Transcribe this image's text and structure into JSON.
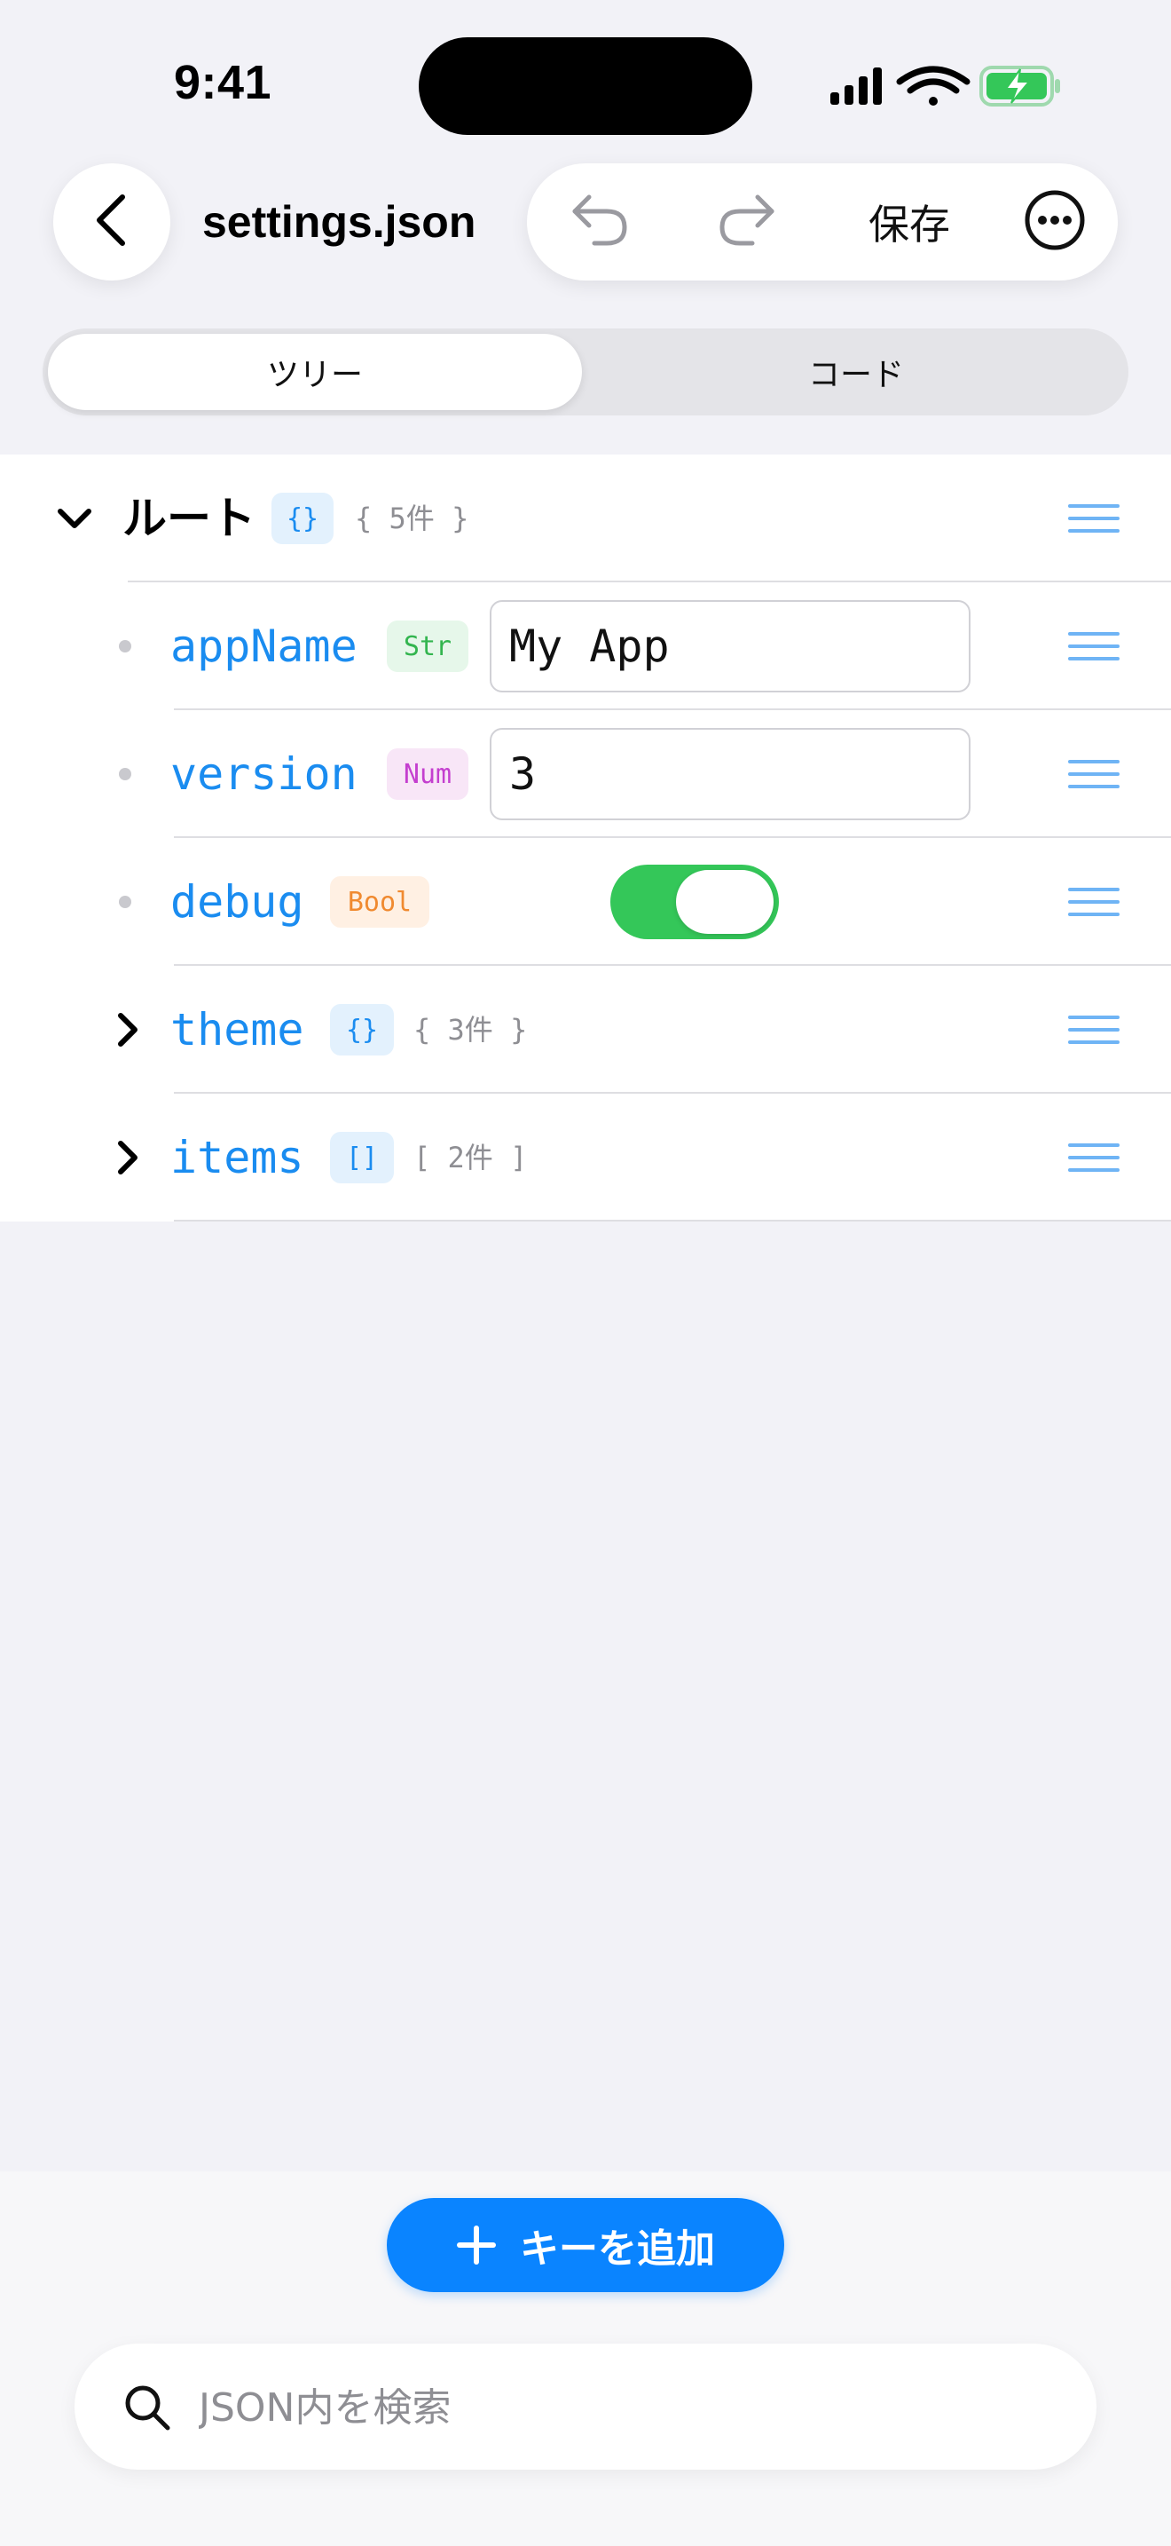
{
  "status_bar": {
    "time": "9:41"
  },
  "nav": {
    "title": "settings.json",
    "save_label": "保存"
  },
  "segment": {
    "tree_label": "ツリー",
    "code_label": "コード",
    "selected": "ツリー"
  },
  "tree": {
    "root": {
      "label": "ルート",
      "badge": "{}",
      "count": "{ 5件 }",
      "expanded": true
    },
    "rows": [
      {
        "key": "appName",
        "type_badge": "Str",
        "value": "My App"
      },
      {
        "key": "version",
        "type_badge": "Num",
        "value": "3"
      },
      {
        "key": "debug",
        "type_badge": "Bool",
        "value": true
      },
      {
        "key": "theme",
        "type_badge": "{}",
        "count": "{ 3件 }",
        "expanded": false
      },
      {
        "key": "items",
        "type_badge": "[]",
        "count": "[ 2件 ]",
        "expanded": false
      }
    ]
  },
  "bottom": {
    "add_key_label": "キーを追加",
    "search_placeholder": "JSON内を検索"
  },
  "colors": {
    "accent": "#0a84ff",
    "key_text": "#1a8cf0",
    "toggle_on": "#34c759",
    "badge_string": "#33b54f",
    "badge_number": "#c43fcf",
    "badge_bool": "#f08a30"
  }
}
